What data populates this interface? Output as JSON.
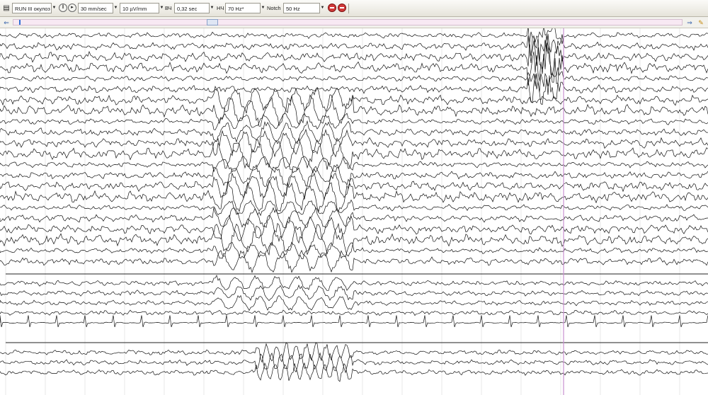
{
  "toolbar": {
    "montage": "RUN III окулоз",
    "speed": "30 mm/sec",
    "sensitivity": "10 µV/mm",
    "tc_label": "ВЧ",
    "tc_value": "0,32 sec",
    "hf_label": "НЧ",
    "hf_value": "70 Hz*",
    "notch_label": "Notch",
    "notch_value": "50 Hz"
  },
  "icons": {
    "play": "play-icon",
    "pause": "pause-icon",
    "stop": "stop-icon",
    "back": "arrow-left-icon",
    "forward": "arrow-right-icon",
    "pen": "pen-icon"
  },
  "colors": {
    "toolbar_bg": "#e6e4da",
    "nav_track": "#f8e9f3",
    "trace": "#111111",
    "grid": "#d8d8d8",
    "marker": "#c98fd0",
    "stop": "#d23a3a"
  },
  "traces": {
    "channel_count_group1": 22,
    "channel_count_group2": 5,
    "channel_count_group3": 3
  }
}
